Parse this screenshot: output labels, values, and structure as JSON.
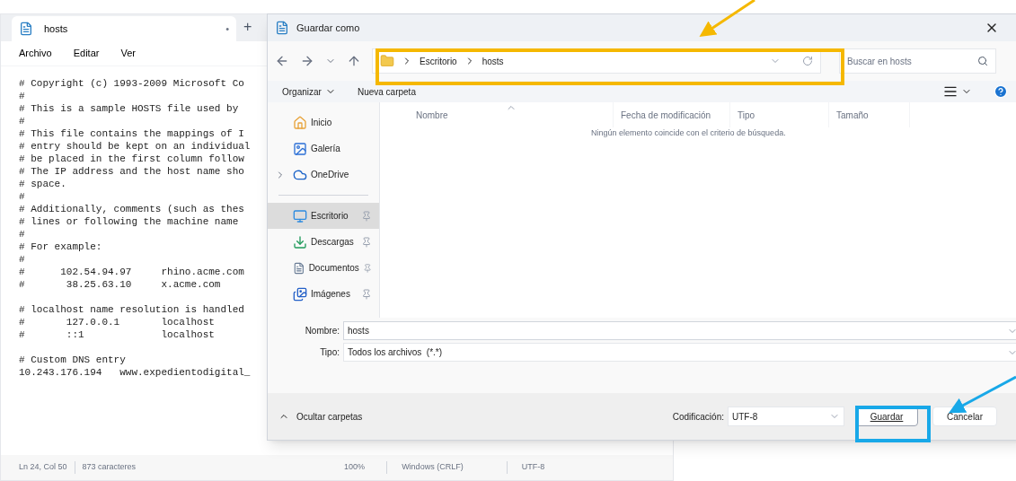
{
  "notepad": {
    "tab": {
      "title": "hosts",
      "unsaved_mark": "•"
    },
    "new_tab": "+",
    "menu": [
      "Archivo",
      "Editar",
      "Ver"
    ],
    "blocks": [
      [
        "# Copyright (c) 1993-2009 Microsoft Co",
        "#",
        "# This is a sample HOSTS file used by",
        "#",
        "# This file contains the mappings of I",
        "# entry should be kept on an individual",
        "# be placed in the first column follow",
        "# The IP address and the host name sho",
        "# space.",
        "#",
        "# Additionally, comments (such as thes",
        "# lines or following the machine name",
        "#",
        "# For example:",
        "#",
        "#      102.54.94.97     rhino.acme.com",
        "#       38.25.63.10     x.acme.com"
      ],
      [
        "# localhost name resolution is handled",
        "#       127.0.0.1       localhost",
        "#       ::1             localhost"
      ],
      [
        "# Custom DNS entry",
        "10.243.176.194   www.expedientodigital_"
      ]
    ],
    "status_bar": [
      "Ln 24, Col 50",
      "873 caracteres",
      "100%",
      "Windows (CRLF)",
      "UTF-8"
    ]
  },
  "dialog": {
    "title": "Guardar como",
    "breadcrumb": [
      "Escritorio",
      "hosts"
    ],
    "search": {
      "placeholder": "Buscar en hosts"
    },
    "toolbar": {
      "organize": "Organizar",
      "new_folder": "Nueva carpeta"
    },
    "nav_top": [
      {
        "label": "Inicio",
        "selected": false,
        "expandable": false
      },
      {
        "label": "Galería",
        "selected": false,
        "expandable": false
      },
      {
        "label": "OneDrive",
        "selected": false,
        "expandable": true
      }
    ],
    "nav_pinned": [
      {
        "label": "Escritorio",
        "selected": true
      },
      {
        "label": "Descargas",
        "selected": false
      },
      {
        "label": "Documentos",
        "selected": false
      },
      {
        "label": "Imágenes",
        "selected": false
      }
    ],
    "columns": [
      "Nombre",
      "Fecha de modificación",
      "Tipo",
      "Tamaño"
    ],
    "empty_message": "Ningún elemento coincide con el criterio de búsqueda.",
    "name_field": {
      "label": "Nombre:",
      "value": "hosts"
    },
    "type_field": {
      "label": "Tipo:",
      "value": "Todos los archivos  (*.*)"
    },
    "hide_folders": "Ocultar carpetas",
    "encoding": {
      "label": "Codificación:",
      "value": "UTF-8"
    },
    "buttons": {
      "save": "Guardar",
      "cancel": "Cancelar"
    }
  }
}
